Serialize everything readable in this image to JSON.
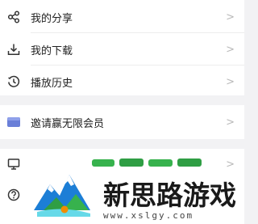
{
  "menu_group_1": {
    "items": [
      {
        "label": "我的分享",
        "icon": "share-icon"
      },
      {
        "label": "我的下载",
        "icon": "download-icon"
      },
      {
        "label": "播放历史",
        "icon": "history-icon"
      }
    ]
  },
  "menu_group_2": {
    "items": [
      {
        "label": "邀请赢无限会员",
        "icon": "invite-card-icon"
      }
    ]
  },
  "menu_group_3": {
    "items": [
      {
        "label": "",
        "icon": "monitor-icon"
      },
      {
        "label": "",
        "icon": "help-icon"
      }
    ]
  },
  "chevron": ">",
  "watermark": {
    "title": "新思路游戏",
    "url": "www.xslgy.com"
  },
  "colors": {
    "background": "#f2f2f4",
    "card": "#ffffff",
    "text": "#222222",
    "chevron": "#b9b9b9",
    "invite_icon": "#6a7fd8"
  }
}
